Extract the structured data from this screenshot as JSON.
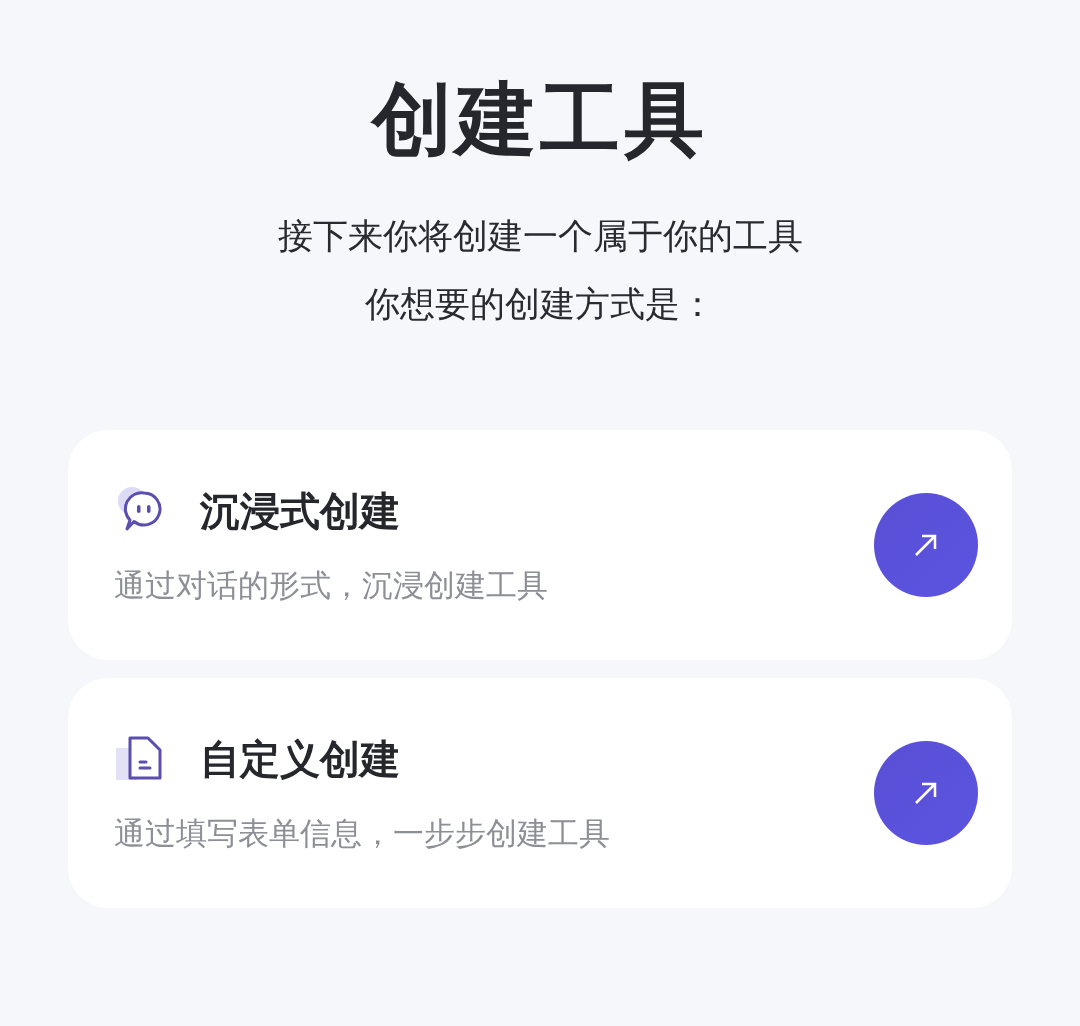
{
  "title": "创建工具",
  "intro": [
    "接下来你将创建一个属于你的工具",
    "你想要的创建方式是："
  ],
  "options": [
    {
      "kind": "chat",
      "title": "沉浸式创建",
      "description": "通过对话的形式，沉浸创建工具"
    },
    {
      "kind": "form",
      "title": "自定义创建",
      "description": "通过填写表单信息，一步步创建工具"
    }
  ]
}
